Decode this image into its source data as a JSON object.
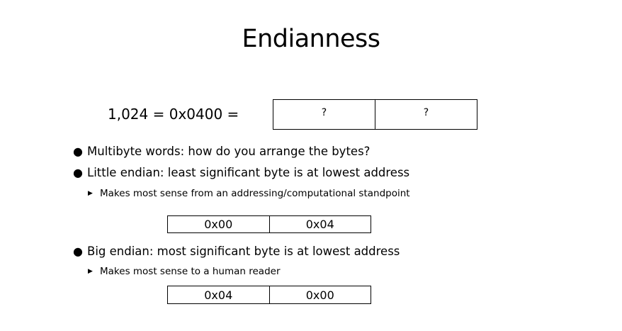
{
  "slide": {
    "title": "Endianness",
    "equation": "1,024  = 0x0400 =",
    "question_box": [
      "?",
      "?"
    ],
    "bullets": [
      "Multibyte words: how do you arrange the bytes?",
      "Little endian: least significant byte is at lowest address",
      "Big endian: most significant byte is at lowest address"
    ],
    "sub_bullets": [
      "Makes most sense from an addressing/computational standpoint",
      "Makes most sense to a human reader"
    ],
    "little_endian_box": [
      "0x00",
      "0x04"
    ],
    "big_endian_box": [
      "0x04",
      "0x00"
    ],
    "bullet_glyph": "●",
    "sub_bullet_glyph": "▶"
  }
}
